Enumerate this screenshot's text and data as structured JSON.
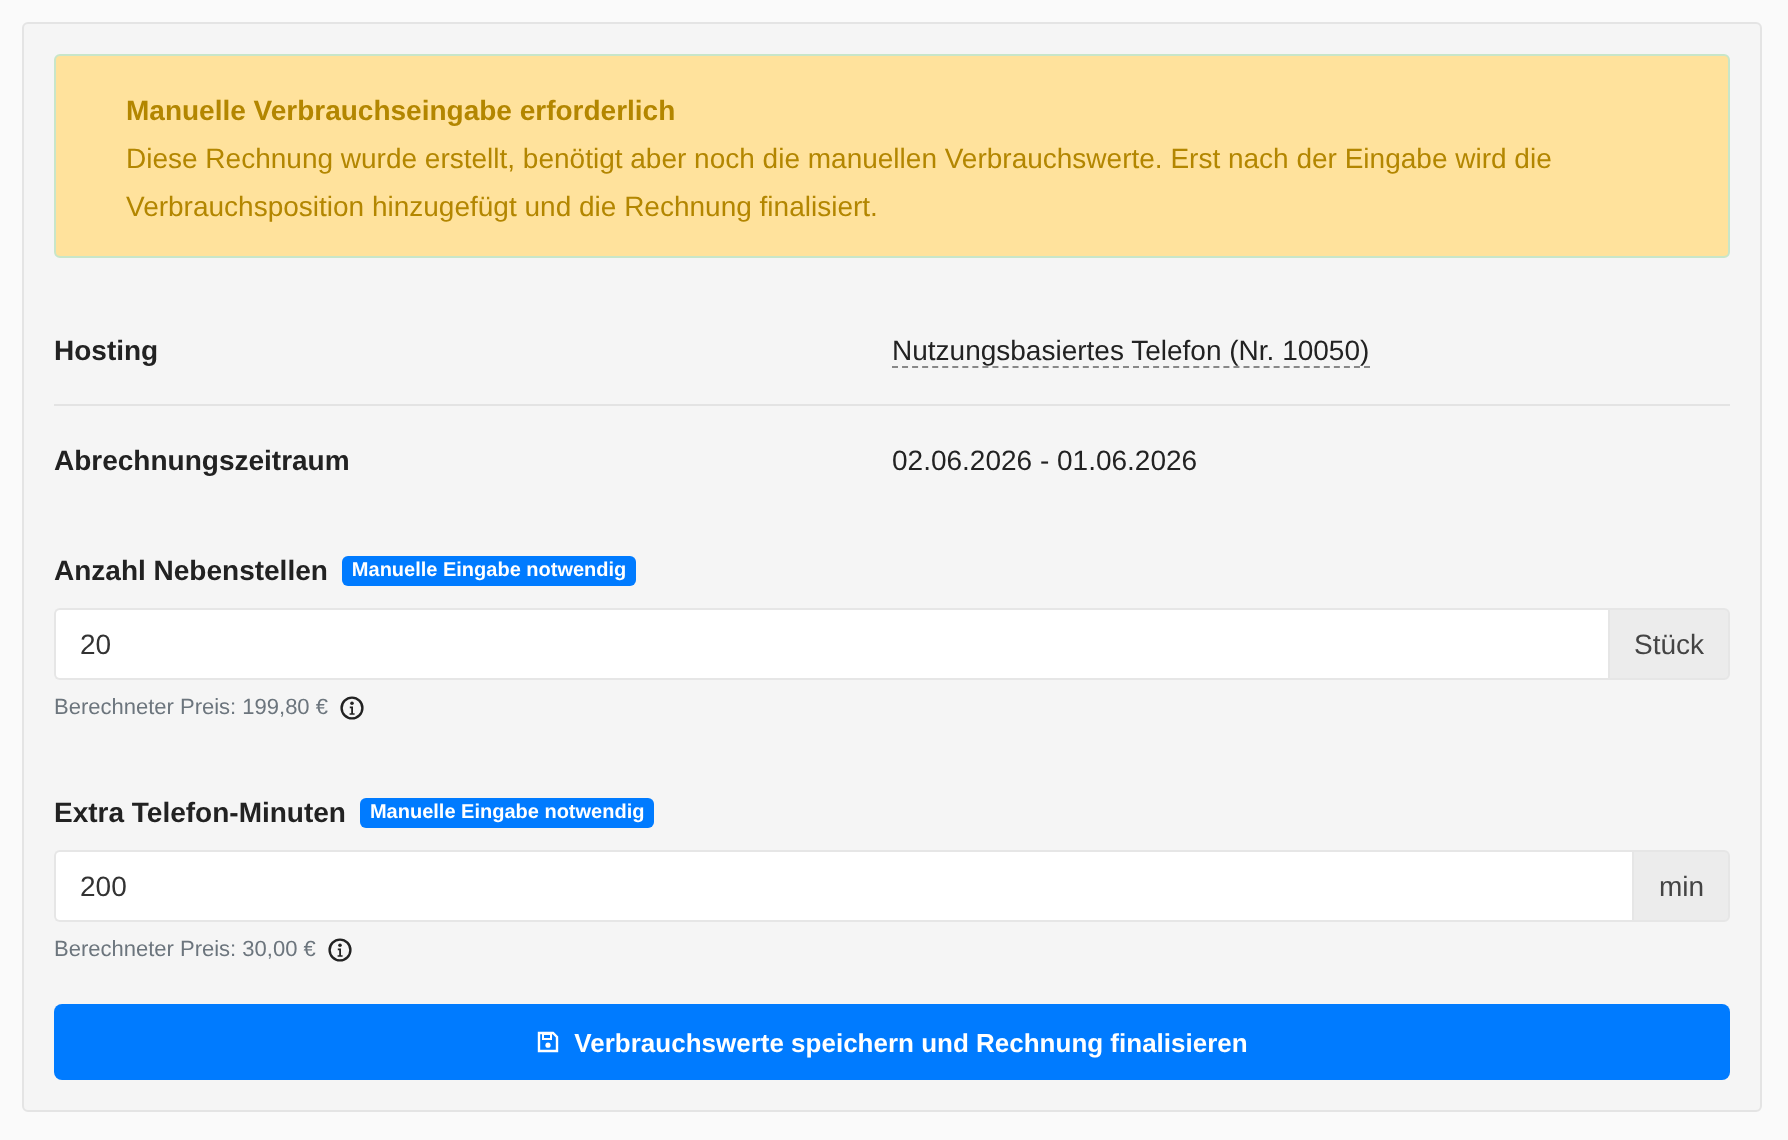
{
  "alert": {
    "title": "Manuelle Verbrauchseingabe erforderlich",
    "message": "Diese Rechnung wurde erstellt, benötigt aber noch die manuellen Verbrauchswerte. Erst nach der Eingabe wird die Verbrauchsposition hinzugefügt und die Rechnung finalisiert."
  },
  "details": [
    {
      "label": "Hosting",
      "value": "Nutzungsbasiertes Telefon (Nr. 10050)",
      "kind": "link"
    },
    {
      "label": "Abrechnungszeitraum",
      "value": "02.06.2026 - 01.06.2026",
      "kind": "text"
    }
  ],
  "fields": [
    {
      "label": "Anzahl Nebenstellen",
      "badge": "Manuelle Eingabe notwendig",
      "value": "20",
      "unit": "Stück",
      "help": "Berechneter Preis: 199,80 €"
    },
    {
      "label": "Extra Telefon-Minuten",
      "badge": "Manuelle Eingabe notwendig",
      "value": "200",
      "unit": "min",
      "help": "Berechneter Preis: 30,00 €"
    }
  ],
  "submit_button": {
    "label": "Verbrauchswerte speichern und Rechnung finalisieren"
  }
}
